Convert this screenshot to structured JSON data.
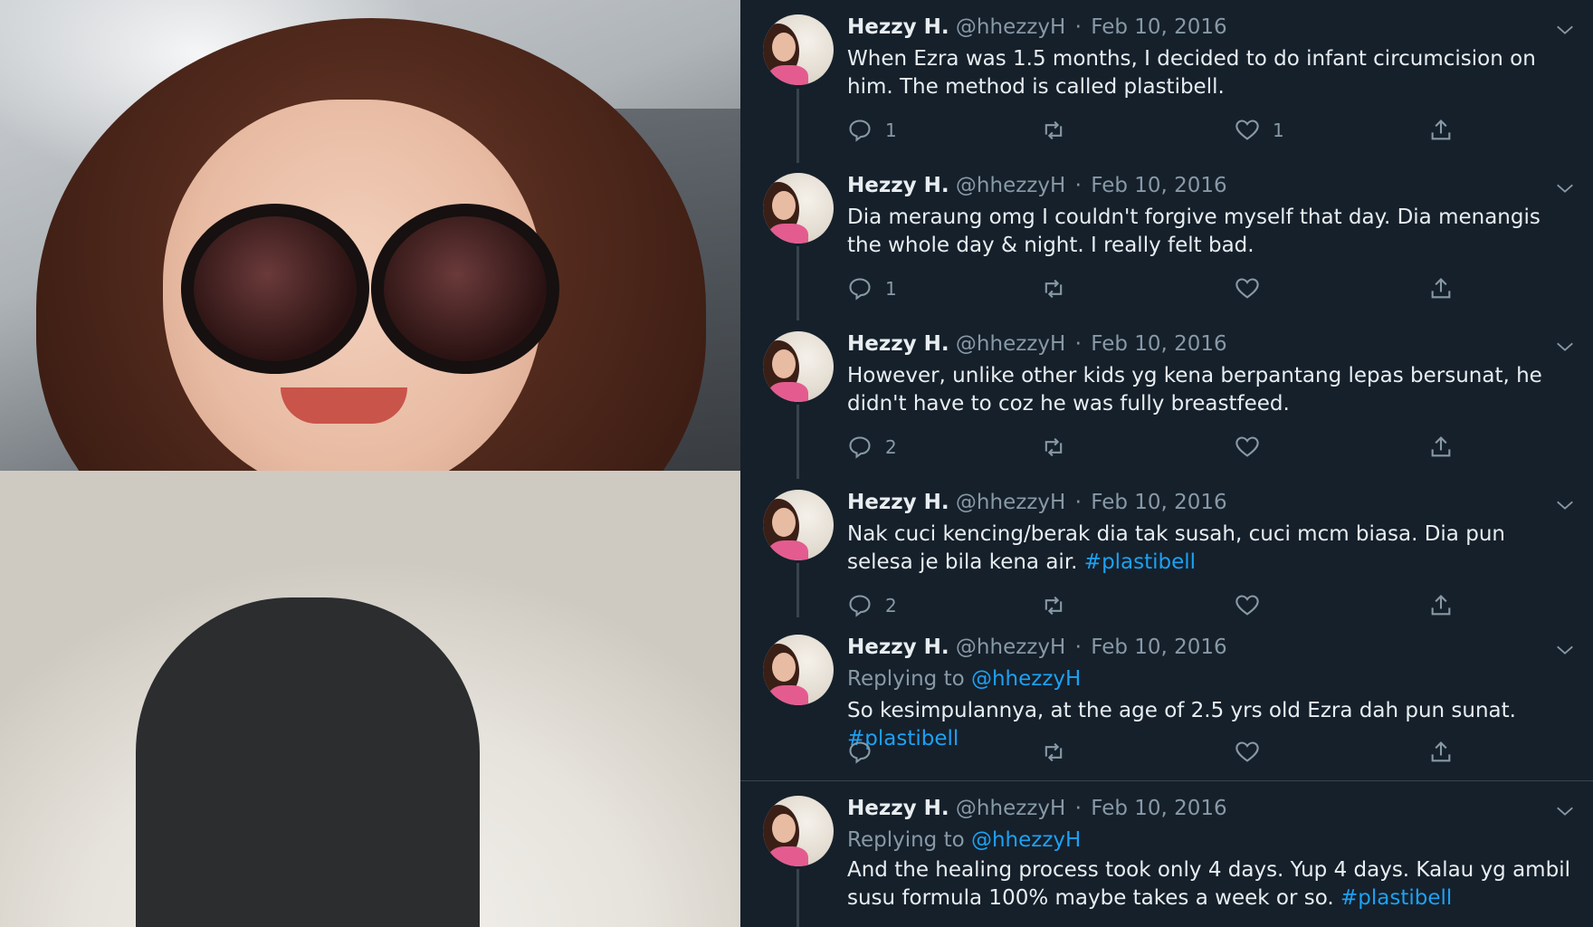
{
  "tweets": [
    {
      "name": "Hezzy H.",
      "handle": "@hhezzyH",
      "dot": "·",
      "date": "Feb 10, 2016",
      "replying_prefix": "",
      "replying_handle": "",
      "text": "When Ezra was 1.5 months, I decided to do infant circumcision on him. The method is called plastibell.",
      "hashtag": "",
      "reply_count": "1",
      "retweet_count": "",
      "like_count": "1"
    },
    {
      "name": "Hezzy H.",
      "handle": "@hhezzyH",
      "dot": "·",
      "date": "Feb 10, 2016",
      "replying_prefix": "",
      "replying_handle": "",
      "text": "Dia meraung omg I couldn't forgive myself that day. Dia menangis the whole day & night. I really felt bad.",
      "hashtag": "",
      "reply_count": "1",
      "retweet_count": "",
      "like_count": ""
    },
    {
      "name": "Hezzy H.",
      "handle": "@hhezzyH",
      "dot": "·",
      "date": "Feb 10, 2016",
      "replying_prefix": "",
      "replying_handle": "",
      "text": "However, unlike other kids yg kena berpantang lepas bersunat, he didn't have to coz he was fully breastfeed.",
      "hashtag": "",
      "reply_count": "2",
      "retweet_count": "",
      "like_count": ""
    },
    {
      "name": "Hezzy H.",
      "handle": "@hhezzyH",
      "dot": "·",
      "date": "Feb 10, 2016",
      "replying_prefix": "",
      "replying_handle": "",
      "text": "Nak cuci kencing/berak dia tak susah, cuci mcm biasa. Dia pun selesa je bila kena air. ",
      "hashtag": "#plastibell",
      "reply_count": "2",
      "retweet_count": "",
      "like_count": ""
    },
    {
      "name": "Hezzy H.",
      "handle": "@hhezzyH",
      "dot": "·",
      "date": "Feb 10, 2016",
      "replying_prefix": "Replying to ",
      "replying_handle": "@hhezzyH",
      "text": "So kesimpulannya, at the age of 2.5 yrs old Ezra dah pun sunat. ",
      "hashtag": "#plastibell",
      "reply_count": "",
      "retweet_count": "",
      "like_count": ""
    },
    {
      "name": "Hezzy H.",
      "handle": "@hhezzyH",
      "dot": "·",
      "date": "Feb 10, 2016",
      "replying_prefix": "Replying to ",
      "replying_handle": "@hhezzyH",
      "text": "And the healing process took only 4 days. Yup 4 days. Kalau yg ambil susu formula 100% maybe takes a week or so. ",
      "hashtag": "#plastibell",
      "reply_count": "",
      "retweet_count": "",
      "like_count": ""
    }
  ],
  "icons": {
    "reply": "reply-icon",
    "retweet": "retweet-icon",
    "like": "heart-icon",
    "share": "share-icon",
    "more": "chevron-down-icon"
  },
  "colors": {
    "background": "#15202b",
    "text": "#e8edf0",
    "secondary": "#8899a6",
    "link": "#1da1f2",
    "border": "#38444d"
  }
}
